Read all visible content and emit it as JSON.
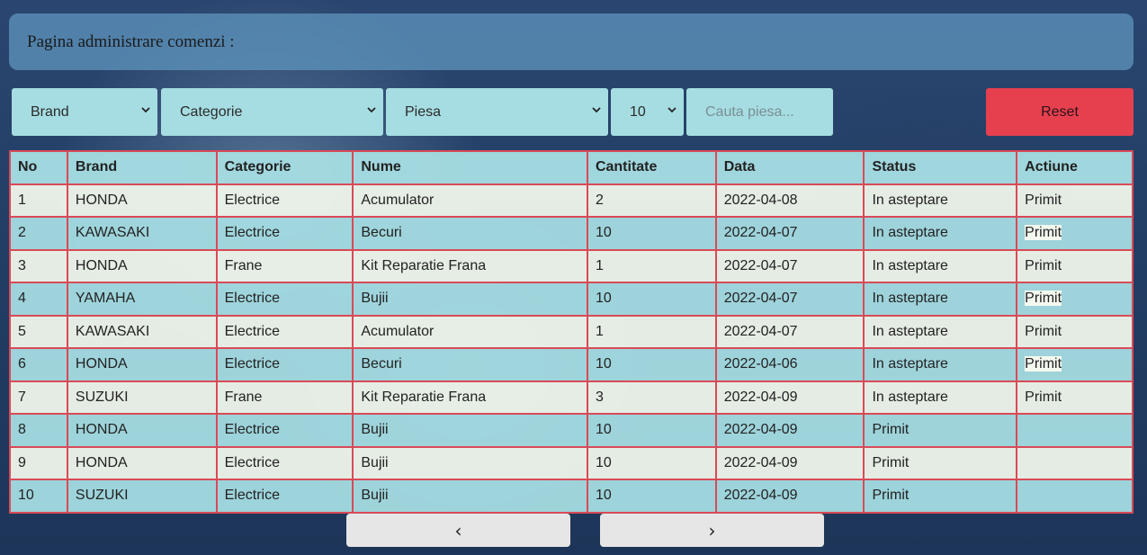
{
  "header": {
    "title": "Pagina administrare comenzi :"
  },
  "filters": {
    "brand": "Brand",
    "categorie": "Categorie",
    "piesa": "Piesa",
    "per_page": "10",
    "search_placeholder": "Cauta piesa...",
    "reset_label": "Reset"
  },
  "table": {
    "headers": [
      "No",
      "Brand",
      "Categorie",
      "Nume",
      "Cantitate",
      "Data",
      "Status",
      "Actiune"
    ],
    "rows": [
      {
        "no": "1",
        "brand": "HONDA",
        "categorie": "Electrice",
        "nume": "Acumulator",
        "cantitate": "2",
        "data": "2022-04-08",
        "status": "In asteptare",
        "actiune": "Primit"
      },
      {
        "no": "2",
        "brand": "KAWASAKI",
        "categorie": "Electrice",
        "nume": "Becuri",
        "cantitate": "10",
        "data": "2022-04-07",
        "status": "In asteptare",
        "actiune": "Primit"
      },
      {
        "no": "3",
        "brand": "HONDA",
        "categorie": "Frane",
        "nume": "Kit Reparatie Frana",
        "cantitate": "1",
        "data": "2022-04-07",
        "status": "In asteptare",
        "actiune": "Primit"
      },
      {
        "no": "4",
        "brand": "YAMAHA",
        "categorie": "Electrice",
        "nume": "Bujii",
        "cantitate": "10",
        "data": "2022-04-07",
        "status": "In asteptare",
        "actiune": "Primit"
      },
      {
        "no": "5",
        "brand": "KAWASAKI",
        "categorie": "Electrice",
        "nume": "Acumulator",
        "cantitate": "1",
        "data": "2022-04-07",
        "status": "In asteptare",
        "actiune": "Primit"
      },
      {
        "no": "6",
        "brand": "HONDA",
        "categorie": "Electrice",
        "nume": "Becuri",
        "cantitate": "10",
        "data": "2022-04-06",
        "status": "In asteptare",
        "actiune": "Primit"
      },
      {
        "no": "7",
        "brand": "SUZUKI",
        "categorie": "Frane",
        "nume": "Kit Reparatie Frana",
        "cantitate": "3",
        "data": "2022-04-09",
        "status": "In asteptare",
        "actiune": "Primit"
      },
      {
        "no": "8",
        "brand": "HONDA",
        "categorie": "Electrice",
        "nume": "Bujii",
        "cantitate": "10",
        "data": "2022-04-09",
        "status": "Primit",
        "actiune": ""
      },
      {
        "no": "9",
        "brand": "HONDA",
        "categorie": "Electrice",
        "nume": "Bujii",
        "cantitate": "10",
        "data": "2022-04-09",
        "status": "Primit",
        "actiune": ""
      },
      {
        "no": "10",
        "brand": "SUZUKI",
        "categorie": "Electrice",
        "nume": "Bujii",
        "cantitate": "10",
        "data": "2022-04-09",
        "status": "Primit",
        "actiune": ""
      }
    ]
  },
  "pager": {
    "prev": "‹",
    "next": "›"
  },
  "icons": {
    "dropdown": "chevron-down-icon"
  },
  "colors": {
    "reset": "#e6404f",
    "table_border": "#d94a57",
    "control_bg": "#a6dde2"
  }
}
